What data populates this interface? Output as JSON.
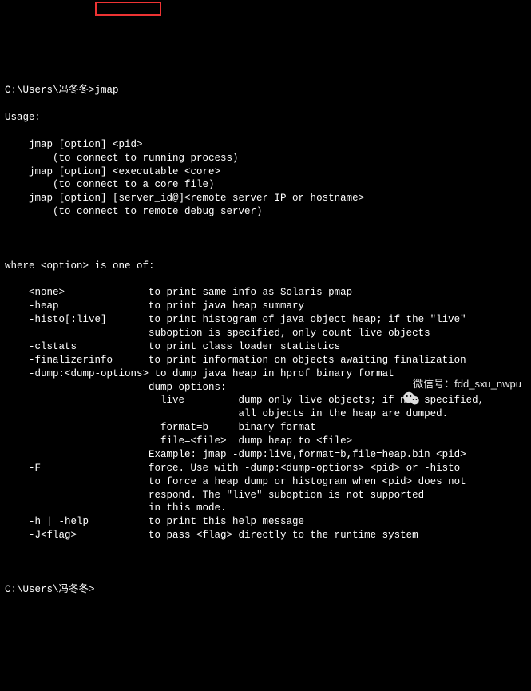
{
  "prompt_line": "C:\\Users\\冯冬冬>jmap",
  "usage_header": "Usage:",
  "usage_lines": [
    "    jmap [option] <pid>",
    "        (to connect to running process)",
    "    jmap [option] <executable <core>",
    "        (to connect to a core file)",
    "    jmap [option] [server_id@]<remote server IP or hostname>",
    "        (to connect to remote debug server)"
  ],
  "options_header": "where <option> is one of:",
  "options": [
    {
      "flag": "    <none>              ",
      "desc": "to print same info as Solaris pmap"
    },
    {
      "flag": "    -heap               ",
      "desc": "to print java heap summary"
    },
    {
      "flag": "    -histo[:live]       ",
      "desc": "to print histogram of java object heap; if the \"live\""
    },
    {
      "flag": "                        ",
      "desc": "suboption is specified, only count live objects"
    },
    {
      "flag": "    -clstats            ",
      "desc": "to print class loader statistics"
    },
    {
      "flag": "    -finalizerinfo      ",
      "desc": "to print information on objects awaiting finalization"
    },
    {
      "flag": "    -dump:<dump-options>",
      "desc": " to dump java heap in hprof binary format"
    },
    {
      "flag": "                        ",
      "desc": "dump-options:"
    },
    {
      "flag": "                        ",
      "desc": "  live         dump only live objects; if not specified,"
    },
    {
      "flag": "                        ",
      "desc": "               all objects in the heap are dumped."
    },
    {
      "flag": "                        ",
      "desc": "  format=b     binary format"
    },
    {
      "flag": "                        ",
      "desc": "  file=<file>  dump heap to <file>"
    },
    {
      "flag": "                        ",
      "desc": "Example: jmap -dump:live,format=b,file=heap.bin <pid>"
    },
    {
      "flag": "    -F                  ",
      "desc": "force. Use with -dump:<dump-options> <pid> or -histo"
    },
    {
      "flag": "                        ",
      "desc": "to force a heap dump or histogram when <pid> does not"
    },
    {
      "flag": "                        ",
      "desc": "respond. The \"live\" suboption is not supported"
    },
    {
      "flag": "                        ",
      "desc": "in this mode."
    },
    {
      "flag": "    -h | -help          ",
      "desc": "to print this help message"
    },
    {
      "flag": "    -J<flag>            ",
      "desc": "to pass <flag> directly to the runtime system"
    }
  ],
  "prompt_end": "C:\\Users\\冯冬冬>",
  "watermark": {
    "label": "微信号：fdd_sxu_nwpu"
  }
}
